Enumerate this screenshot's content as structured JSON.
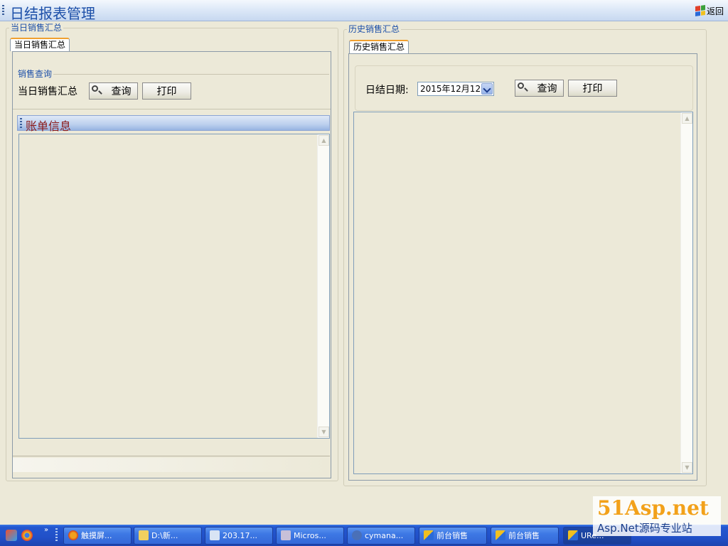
{
  "window": {
    "title": "日结报表管理",
    "back_label": "返回"
  },
  "today_panel": {
    "legend": "当日销售汇总",
    "tab_label": "当日销售汇总",
    "query_legend": "销售查询",
    "query_label": "当日销售汇总",
    "query_button": "查询",
    "print_button": "打印",
    "section_title": "账单信息"
  },
  "history_panel": {
    "legend": "历史销售汇总",
    "tab_label": "历史销售汇总",
    "date_label": "日结日期:",
    "date_value": "2015年12月12日",
    "query_button": "查询",
    "print_button": "打印"
  },
  "taskbar": {
    "items": [
      {
        "label": "触摸屏...",
        "icon": "firefox-icon"
      },
      {
        "label": "D:\\新...",
        "icon": "folder-icon"
      },
      {
        "label": "203.17...",
        "icon": "remote-desktop-icon"
      },
      {
        "label": "Micros...",
        "icon": "visual-studio-icon"
      },
      {
        "label": "cymana...",
        "icon": "link-icon"
      },
      {
        "label": "前台销售",
        "icon": "app-window-icon"
      },
      {
        "label": "前台销售",
        "icon": "app-window-icon"
      },
      {
        "label": "URe...",
        "icon": "app-window-icon"
      }
    ]
  },
  "watermark": {
    "logo": "51Asp.net",
    "tagline": "Asp.Net源码专业站"
  },
  "colors": {
    "accent_blue": "#1c4fa8",
    "section_title_red": "#8b1a1a",
    "tab_highlight": "#f0a030",
    "taskbar_blue": "#2150c8"
  }
}
